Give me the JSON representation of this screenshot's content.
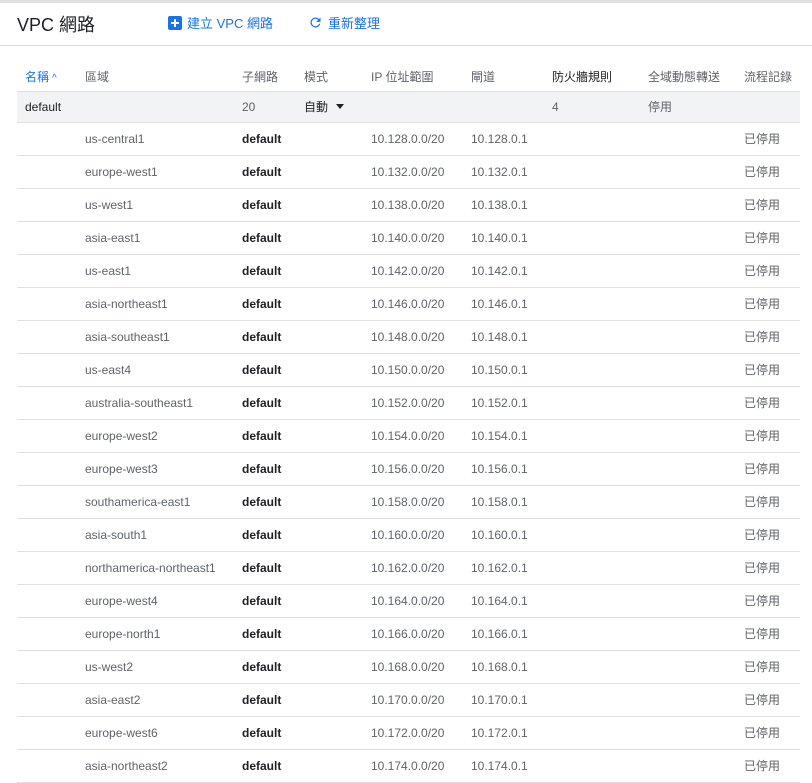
{
  "header": {
    "title": "VPC 網路",
    "create_label": "建立 VPC 網路",
    "refresh_label": "重新整理"
  },
  "columns": {
    "name": "名稱",
    "sort_indicator": "^",
    "region": "區域",
    "subnet": "子網路",
    "mode": "模式",
    "ip_range": "IP 位址範圍",
    "gateway": "閘道",
    "firewall_rules": "防火牆規則",
    "global_routing": "全域動態轉送",
    "flow_logs": "流程記錄"
  },
  "network": {
    "name": "default",
    "subnet_count": "20",
    "mode": "自動",
    "firewall_rules": "4",
    "global_routing": "停用"
  },
  "subnets": [
    {
      "region": "us-central1",
      "subnet": "default",
      "ip": "10.128.0.0/20",
      "gateway": "10.128.0.1",
      "flow_logs": "已停用"
    },
    {
      "region": "europe-west1",
      "subnet": "default",
      "ip": "10.132.0.0/20",
      "gateway": "10.132.0.1",
      "flow_logs": "已停用"
    },
    {
      "region": "us-west1",
      "subnet": "default",
      "ip": "10.138.0.0/20",
      "gateway": "10.138.0.1",
      "flow_logs": "已停用"
    },
    {
      "region": "asia-east1",
      "subnet": "default",
      "ip": "10.140.0.0/20",
      "gateway": "10.140.0.1",
      "flow_logs": "已停用"
    },
    {
      "region": "us-east1",
      "subnet": "default",
      "ip": "10.142.0.0/20",
      "gateway": "10.142.0.1",
      "flow_logs": "已停用"
    },
    {
      "region": "asia-northeast1",
      "subnet": "default",
      "ip": "10.146.0.0/20",
      "gateway": "10.146.0.1",
      "flow_logs": "已停用"
    },
    {
      "region": "asia-southeast1",
      "subnet": "default",
      "ip": "10.148.0.0/20",
      "gateway": "10.148.0.1",
      "flow_logs": "已停用"
    },
    {
      "region": "us-east4",
      "subnet": "default",
      "ip": "10.150.0.0/20",
      "gateway": "10.150.0.1",
      "flow_logs": "已停用"
    },
    {
      "region": "australia-southeast1",
      "subnet": "default",
      "ip": "10.152.0.0/20",
      "gateway": "10.152.0.1",
      "flow_logs": "已停用"
    },
    {
      "region": "europe-west2",
      "subnet": "default",
      "ip": "10.154.0.0/20",
      "gateway": "10.154.0.1",
      "flow_logs": "已停用"
    },
    {
      "region": "europe-west3",
      "subnet": "default",
      "ip": "10.156.0.0/20",
      "gateway": "10.156.0.1",
      "flow_logs": "已停用"
    },
    {
      "region": "southamerica-east1",
      "subnet": "default",
      "ip": "10.158.0.0/20",
      "gateway": "10.158.0.1",
      "flow_logs": "已停用"
    },
    {
      "region": "asia-south1",
      "subnet": "default",
      "ip": "10.160.0.0/20",
      "gateway": "10.160.0.1",
      "flow_logs": "已停用"
    },
    {
      "region": "northamerica-northeast1",
      "subnet": "default",
      "ip": "10.162.0.0/20",
      "gateway": "10.162.0.1",
      "flow_logs": "已停用"
    },
    {
      "region": "europe-west4",
      "subnet": "default",
      "ip": "10.164.0.0/20",
      "gateway": "10.164.0.1",
      "flow_logs": "已停用"
    },
    {
      "region": "europe-north1",
      "subnet": "default",
      "ip": "10.166.0.0/20",
      "gateway": "10.166.0.1",
      "flow_logs": "已停用"
    },
    {
      "region": "us-west2",
      "subnet": "default",
      "ip": "10.168.0.0/20",
      "gateway": "10.168.0.1",
      "flow_logs": "已停用"
    },
    {
      "region": "asia-east2",
      "subnet": "default",
      "ip": "10.170.0.0/20",
      "gateway": "10.170.0.1",
      "flow_logs": "已停用"
    },
    {
      "region": "europe-west6",
      "subnet": "default",
      "ip": "10.172.0.0/20",
      "gateway": "10.172.0.1",
      "flow_logs": "已停用"
    },
    {
      "region": "asia-northeast2",
      "subnet": "default",
      "ip": "10.174.0.0/20",
      "gateway": "10.174.0.1",
      "flow_logs": "已停用"
    }
  ],
  "colors": {
    "accent": "#1a73e8",
    "text": "#202124",
    "muted": "#5f6368",
    "divider": "#e0e0e0",
    "group_row_bg": "#f1f3f4"
  },
  "icons": {
    "create": "add-box-icon",
    "refresh": "refresh-icon",
    "sort": "arrow-up-icon",
    "mode_dropdown": "caret-down-icon"
  }
}
